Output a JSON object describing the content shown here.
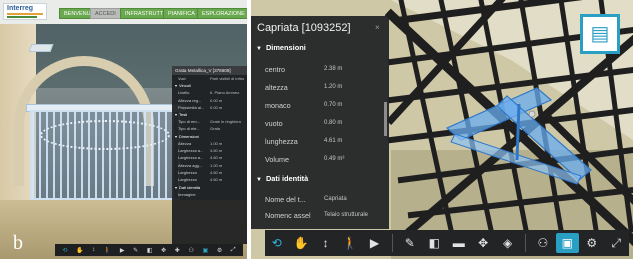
{
  "left_view": {
    "toolbar_buttons": [
      "BENVENUTO",
      "ACCEDI",
      "INFRASTRUTTURE",
      "PIANIFICA",
      "ESPLORAZIONE"
    ],
    "logo_text": "Interreg",
    "panel_label": "b",
    "properties": {
      "title": "Grata Metallica_V [378608]",
      "rows": [
        {
          "type": "row",
          "key": "Voci",
          "value": "Parti visibili di infissi"
        },
        {
          "type": "section",
          "label": "Vincoli"
        },
        {
          "type": "row",
          "key": "Livello",
          "value": "6. Piano Ammez."
        },
        {
          "type": "row",
          "key": "Altezza reg...",
          "value": "0.00 m"
        },
        {
          "type": "row",
          "key": "Prossimità al...",
          "value": "0.00 m"
        },
        {
          "type": "section",
          "label": "Testi"
        },
        {
          "type": "row",
          "key": "Tipo di ren...",
          "value": "Grate in ringhiera"
        },
        {
          "type": "row",
          "key": "Tipo di ele...",
          "value": "Grata"
        },
        {
          "type": "section",
          "label": "Dimensioni"
        },
        {
          "type": "row",
          "key": "Altezza",
          "value": "1.00 m"
        },
        {
          "type": "row",
          "key": "Larghezza a...",
          "value": "4.60 m"
        },
        {
          "type": "row",
          "key": "Larghezza a...",
          "value": "4.60 m"
        },
        {
          "type": "row",
          "key": "Altezza agg...",
          "value": "1.00 m"
        },
        {
          "type": "row",
          "key": "Larghezza",
          "value": "4.60 m"
        },
        {
          "type": "row",
          "key": "Larghezza",
          "value": "4.60 m"
        },
        {
          "type": "section",
          "label": "Dati identità"
        },
        {
          "type": "row",
          "key": "Immagine",
          "value": ""
        }
      ]
    },
    "bottom_toolbar_icons": [
      "orbit-icon",
      "pan-icon",
      "zoom-icon",
      "walk-icon",
      "camera-icon",
      "measure-icon",
      "section-icon",
      "explode-icon",
      "move-icon",
      "model-browser-icon",
      "properties-icon",
      "settings-icon",
      "fullscreen-icon"
    ]
  },
  "right_view": {
    "properties": {
      "title": "Capriata [1093252]",
      "close_glyph": "×",
      "section_dimensions": "Dimensioni",
      "rows": [
        {
          "key": "centro",
          "value": "2.38 m"
        },
        {
          "key": "altezza",
          "value": "1.20 m"
        },
        {
          "key": "monaco",
          "value": "0.70 m"
        },
        {
          "key": "vuoto",
          "value": "0.80 m"
        },
        {
          "key": "lunghezza",
          "value": "4.61 m"
        },
        {
          "key": "Volume",
          "value": "0.49 m³"
        }
      ],
      "section_identity": "Dati identità",
      "identity_rows": [
        {
          "key": "Nome del t...",
          "value": "Capriata"
        },
        {
          "key": "Nomenc assel",
          "value": "Telaio strutturale"
        }
      ]
    },
    "toolbar_icons": [
      {
        "name": "orbit-icon",
        "glyph": "⟲",
        "state": "active"
      },
      {
        "name": "pan-icon",
        "glyph": "✋",
        "state": ""
      },
      {
        "name": "zoom-icon",
        "glyph": "↕",
        "state": ""
      },
      {
        "name": "walk-icon",
        "glyph": "🚶",
        "state": ""
      },
      {
        "name": "camera-icon",
        "glyph": "▶",
        "state": ""
      },
      {
        "name": "sep",
        "glyph": "",
        "state": ""
      },
      {
        "name": "measure-icon",
        "glyph": "✎",
        "state": ""
      },
      {
        "name": "section-icon",
        "glyph": "◧",
        "state": ""
      },
      {
        "name": "folder-icon",
        "glyph": "▬",
        "state": ""
      },
      {
        "name": "explode-icon",
        "glyph": "✥",
        "state": ""
      },
      {
        "name": "model-icon",
        "glyph": "◈",
        "state": ""
      },
      {
        "name": "sep",
        "glyph": "",
        "state": ""
      },
      {
        "name": "structure-icon",
        "glyph": "⚇",
        "state": ""
      },
      {
        "name": "properties-icon",
        "glyph": "▣",
        "state": "selected"
      },
      {
        "name": "settings-icon",
        "glyph": "⚙",
        "state": ""
      },
      {
        "name": "fullscreen-icon",
        "glyph": "⤢",
        "state": ""
      }
    ],
    "corner_icon": "properties-icon",
    "colors": {
      "accent": "#2a9fc4",
      "selection": "#5aa6e8",
      "beams": "#222222",
      "wall": "#c9c29f"
    }
  }
}
